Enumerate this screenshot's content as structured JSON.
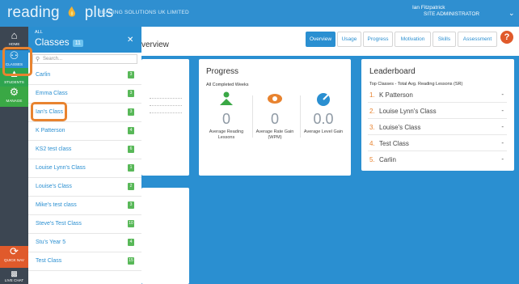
{
  "header": {
    "logo_left": "reading",
    "logo_right": "plus",
    "company": "READING SOLUTIONS UK LIMITED",
    "user_name": "Ian Fitzpatrick",
    "user_role": "SITE ADMINISTRATOR"
  },
  "rail": {
    "home": "HOME",
    "classes": "CLASSES",
    "students": "STUDENTS",
    "manage": "MANAGE",
    "quick": "QUICK NAV",
    "chat": "LIVE CHAT"
  },
  "panel": {
    "all_label": "ALL",
    "title": "Classes",
    "count": "11",
    "search_placeholder": "Search...",
    "classes": [
      {
        "name": "Carlin",
        "count": "3"
      },
      {
        "name": "Emma Class",
        "count": "3"
      },
      {
        "name": "Ian's Class",
        "count": "3"
      },
      {
        "name": "K Patterson",
        "count": "4"
      },
      {
        "name": "KS2 test class",
        "count": "6"
      },
      {
        "name": "Louise Lynn's Class",
        "count": "1"
      },
      {
        "name": "Louise's Class",
        "count": "2"
      },
      {
        "name": "Mike's test class",
        "count": "3"
      },
      {
        "name": "Steve's Test Class",
        "count": "10"
      },
      {
        "name": "Stu's Year 5",
        "count": "4"
      },
      {
        "name": "Test Class",
        "count": "15"
      }
    ]
  },
  "main": {
    "title_fragment": "verview",
    "tabs": [
      "Overview",
      "Usage",
      "Progress",
      "Motivation",
      "Skills",
      "Assessment"
    ],
    "active_tab": "Overview"
  },
  "progress": {
    "title": "Progress",
    "subtitle": "All Completed Weeks",
    "metrics": [
      {
        "value": "0",
        "label": "Average Reading Lessons",
        "icon": "reader-icon",
        "color": "#3aa845"
      },
      {
        "value": "0",
        "label": "Average Rate Gain (WPM)",
        "icon": "eye-icon",
        "color": "#e8832f"
      },
      {
        "value": "0.0",
        "label": "Average Level Gain",
        "icon": "gauge-icon",
        "color": "#2a8fd1"
      }
    ]
  },
  "leaderboard": {
    "title": "Leaderboard",
    "subtitle": "Top Classes - Total Avg. Reading Lessons (SR)",
    "rows": [
      {
        "rank": "1.",
        "name": "K Patterson",
        "value": "-"
      },
      {
        "rank": "2.",
        "name": "Louise Lynn's Class",
        "value": "-"
      },
      {
        "rank": "3.",
        "name": "Louise's Class",
        "value": "-"
      },
      {
        "rank": "4.",
        "name": "Test Class",
        "value": "-"
      },
      {
        "rank": "5.",
        "name": "Carlin",
        "value": "-"
      }
    ]
  },
  "colors": {
    "brand_blue": "#2a8fd1",
    "highlight_orange": "#e8832f",
    "badge_green": "#58b858"
  }
}
